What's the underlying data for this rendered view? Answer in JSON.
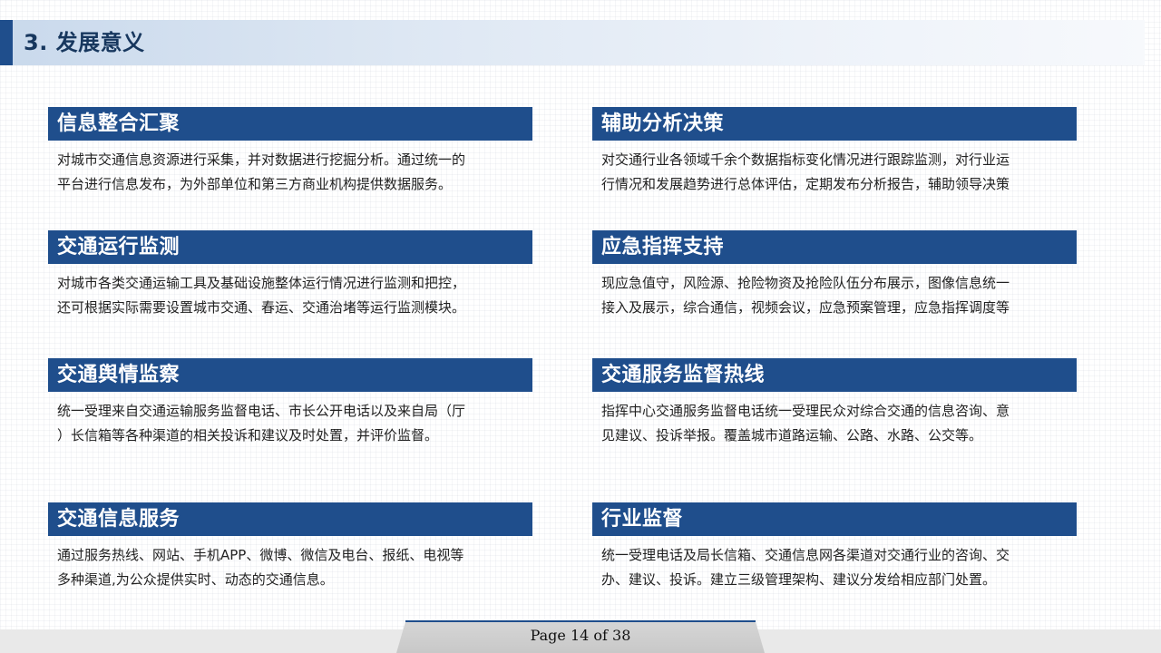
{
  "header": {
    "title": "3. 发展意义"
  },
  "cards": [
    {
      "title": "信息整合汇聚",
      "lines": [
        "对城市交通信息资源进行采集，并对数据进行挖掘分析。通过统一的",
        "平台进行信息发布，为外部单位和第三方商业机构提供数据服务。"
      ]
    },
    {
      "title": "辅助分析决策",
      "lines": [
        "对交通行业各领域千余个数据指标变化情况进行跟踪监测，对行业运",
        "行情况和发展趋势进行总体评估，定期发布分析报告，辅助领导决策"
      ]
    },
    {
      "title": "交通运行监测",
      "lines": [
        "对城市各类交通运输工具及基础设施整体运行情况进行监测和把控，",
        "还可根据实际需要设置城市交通、春运、交通治堵等运行监测模块。"
      ]
    },
    {
      "title": "应急指挥支持",
      "lines": [
        "现应急值守，风险源、抢险物资及抢险队伍分布展示，图像信息统一",
        "接入及展示，综合通信，视频会议，应急预案管理，应急指挥调度等"
      ]
    },
    {
      "title": "交通舆情监察",
      "lines": [
        "统一受理来自交通运输服务监督电话、市长公开电话以及来自局（厅",
        "）长信箱等各种渠道的相关投诉和建议及时处置，并评价监督。"
      ]
    },
    {
      "title": "交通服务监督热线",
      "lines": [
        "指挥中心交通服务监督电话统一受理民众对综合交通的信息咨询、意",
        "见建议、投诉举报。覆盖城市道路运输、公路、水路、公交等。"
      ]
    },
    {
      "title": "交通信息服务",
      "lines": [
        "通过服务热线、网站、手机APP、微博、微信及电台、报纸、电视等",
        "多种渠道,为公众提供实时、动态的交通信息。"
      ]
    },
    {
      "title": "行业监督",
      "lines": [
        "统一受理电话及局长信箱、交通信息网各渠道对交通行业的咨询、交",
        "办、建议、投诉。建立三级管理架构、建议分发给相应部门处置。"
      ]
    }
  ],
  "footer": {
    "page_label": "Page 14 of 38"
  },
  "colors": {
    "accent": "#1f4e8c",
    "title_text": "#17375e"
  }
}
